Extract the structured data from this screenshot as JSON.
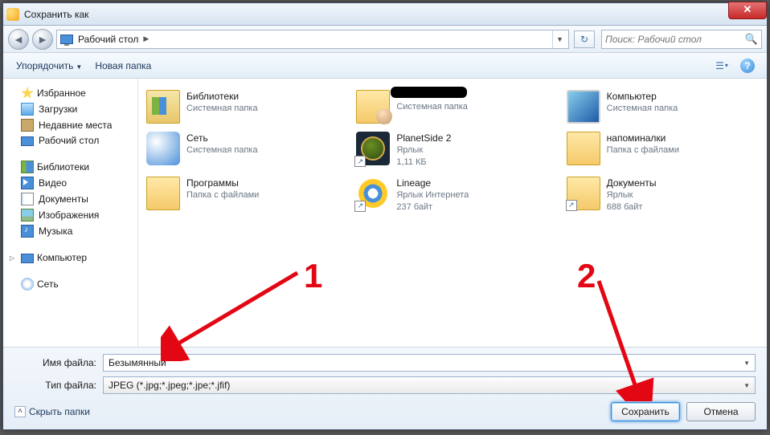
{
  "window": {
    "title": "Сохранить как"
  },
  "nav": {
    "location": "Рабочий стол",
    "search_placeholder": "Поиск: Рабочий стол"
  },
  "toolbar": {
    "organize": "Упорядочить",
    "new_folder": "Новая папка"
  },
  "sidebar": {
    "favorites": {
      "label": "Избранное",
      "items": [
        {
          "label": "Загрузки"
        },
        {
          "label": "Недавние места"
        },
        {
          "label": "Рабочий стол"
        }
      ]
    },
    "libraries": {
      "label": "Библиотеки",
      "items": [
        {
          "label": "Видео"
        },
        {
          "label": "Документы"
        },
        {
          "label": "Изображения"
        },
        {
          "label": "Музыка"
        }
      ]
    },
    "computer": {
      "label": "Компьютер"
    },
    "network": {
      "label": "Сеть"
    }
  },
  "content": {
    "items": [
      {
        "name": "Библиотеки",
        "sub1": "Системная папка",
        "sub2": ""
      },
      {
        "name": "",
        "sub1": "Системная папка",
        "sub2": ""
      },
      {
        "name": "Компьютер",
        "sub1": "Системная папка",
        "sub2": ""
      },
      {
        "name": "Сеть",
        "sub1": "Системная папка",
        "sub2": ""
      },
      {
        "name": "PlanetSide 2",
        "sub1": "Ярлык",
        "sub2": "1,11 КБ"
      },
      {
        "name": "напоминалки",
        "sub1": "Папка с файлами",
        "sub2": ""
      },
      {
        "name": "Программы",
        "sub1": "Папка с файлами",
        "sub2": ""
      },
      {
        "name": "Lineage",
        "sub1": "Ярлык Интернета",
        "sub2": "237 байт"
      },
      {
        "name": "Документы",
        "sub1": "Ярлык",
        "sub2": "688 байт"
      }
    ]
  },
  "bottom": {
    "filename_label": "Имя файла:",
    "filename_value": "Безымянный",
    "filetype_label": "Тип файла:",
    "filetype_value": "JPEG (*.jpg;*.jpeg;*.jpe;*.jfif)",
    "hide_folders": "Скрыть папки",
    "save": "Сохранить",
    "cancel": "Отмена"
  },
  "annotations": {
    "one": "1",
    "two": "2"
  }
}
